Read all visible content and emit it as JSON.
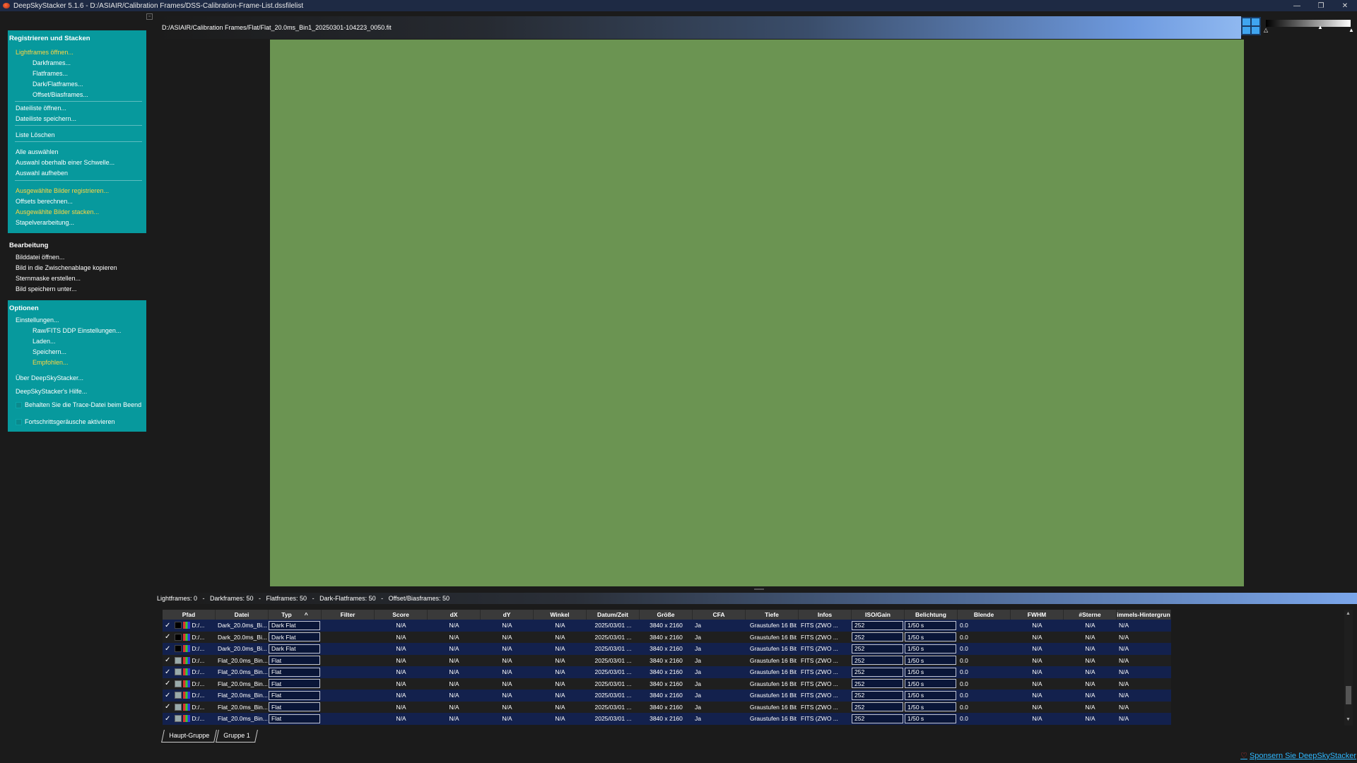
{
  "window": {
    "title": "DeepSkyStacker 5.1.6 - D:/ASIAIR/Calibration Frames/DSS-Calibration-Frame-List.dssfilelist",
    "controls": [
      "—",
      "❐",
      "✕"
    ]
  },
  "sidebar": {
    "collapse_glyph": "▫",
    "stack_section": {
      "title": "Registrieren und Stacken",
      "lightframes": "Lightframes öffnen...",
      "darkframes": "Darkframes...",
      "flatframes": "Flatframes...",
      "darkflatframes": "Dark/Flatframes...",
      "offsetframes": "Offset/Biasframes...",
      "open_list": "Dateiliste öffnen...",
      "save_list": "Dateiliste speichern...",
      "clear_list": "Liste Löschen",
      "select_all": "Alle auswählen",
      "select_threshold": "Auswahl oberhalb einer Schwelle...",
      "deselect": "Auswahl aufheben",
      "register_selected": "Ausgewählte Bilder registrieren...",
      "compute_offsets": "Offsets berechnen...",
      "stack_selected": "Ausgewählte Bilder stacken...",
      "batch": "Stapelverarbeitung..."
    },
    "edit_section": {
      "title": "Bearbeitung",
      "open_image": "Bilddatei öffnen...",
      "copy_clipboard": "Bild in die Zwischenablage kopieren",
      "star_mask": "Sternmaske erstellen...",
      "save_image": "Bild speichern unter..."
    },
    "options_section": {
      "title": "Optionen",
      "settings": "Einstellungen...",
      "raw_fits": "Raw/FITS DDP Einstellungen...",
      "load": "Laden...",
      "save": "Speichern...",
      "recommended": "Empfohlen...",
      "about": "Über DeepSkyStacker...",
      "help": "DeepSkyStacker's Hilfe...",
      "keep_trace": "Behalten Sie die Trace-Datei beim Beend",
      "progress_sounds": "Fortschrittsgeräusche aktivieren"
    }
  },
  "viewer": {
    "file_path": "D:/ASIAIR/Calibration Frames/Flat/Flat_20.0ms_Bin1_20250301-104223_0050.fit",
    "image_color": "#6b9452"
  },
  "counts": {
    "text": "Lightframes: 0   -   Darkframes: 50   -   Flatframes: 50   -   Dark-Flatframes: 50   -   Offset/Biasframes: 50"
  },
  "table": {
    "columns": [
      "Pfad",
      "Datei",
      "Typ",
      "Filter",
      "Score",
      "dX",
      "dY",
      "Winkel",
      "Datum/Zeit",
      "Größe",
      "CFA",
      "Tiefe",
      "Infos",
      "ISO/Gain",
      "Belichtung",
      "Blende",
      "FWHM",
      "#Sterne",
      "immels-Hintergrun"
    ],
    "sort_indicator": "^",
    "rows": [
      {
        "check": "✓",
        "path": "D:/...",
        "file": "Dark_20.0ms_Bi...",
        "type": "Dark Flat",
        "score": "N/A",
        "dx": "N/A",
        "dy": "N/A",
        "angle": "N/A",
        "datetime": "2025/03/01 ...",
        "size": "3840 x 2160",
        "cfa": "Ja",
        "depth": "Graustufen 16 Bit",
        "info": "FITS (ZWO ...",
        "iso": "252",
        "exposure": "1/50 s",
        "aperture": "0.0",
        "fwhm": "N/A",
        "stars": "N/A",
        "bg": "N/A"
      },
      {
        "check": "✓",
        "path": "D:/...",
        "file": "Dark_20.0ms_Bi...",
        "type": "Dark Flat",
        "score": "N/A",
        "dx": "N/A",
        "dy": "N/A",
        "angle": "N/A",
        "datetime": "2025/03/01 ...",
        "size": "3840 x 2160",
        "cfa": "Ja",
        "depth": "Graustufen 16 Bit",
        "info": "FITS (ZWO ...",
        "iso": "252",
        "exposure": "1/50 s",
        "aperture": "0.0",
        "fwhm": "N/A",
        "stars": "N/A",
        "bg": "N/A"
      },
      {
        "check": "✓",
        "path": "D:/...",
        "file": "Dark_20.0ms_Bi...",
        "type": "Dark Flat",
        "score": "N/A",
        "dx": "N/A",
        "dy": "N/A",
        "angle": "N/A",
        "datetime": "2025/03/01 ...",
        "size": "3840 x 2160",
        "cfa": "Ja",
        "depth": "Graustufen 16 Bit",
        "info": "FITS (ZWO ...",
        "iso": "252",
        "exposure": "1/50 s",
        "aperture": "0.0",
        "fwhm": "N/A",
        "stars": "N/A",
        "bg": "N/A"
      },
      {
        "check": "✓",
        "path": "D:/...",
        "file": "Flat_20.0ms_Bin...",
        "type": "Flat",
        "score": "N/A",
        "dx": "N/A",
        "dy": "N/A",
        "angle": "N/A",
        "datetime": "2025/03/01 ...",
        "size": "3840 x 2160",
        "cfa": "Ja",
        "depth": "Graustufen 16 Bit",
        "info": "FITS (ZWO ...",
        "iso": "252",
        "exposure": "1/50 s",
        "aperture": "0.0",
        "fwhm": "N/A",
        "stars": "N/A",
        "bg": "N/A"
      },
      {
        "check": "✓",
        "path": "D:/...",
        "file": "Flat_20.0ms_Bin...",
        "type": "Flat",
        "score": "N/A",
        "dx": "N/A",
        "dy": "N/A",
        "angle": "N/A",
        "datetime": "2025/03/01 ...",
        "size": "3840 x 2160",
        "cfa": "Ja",
        "depth": "Graustufen 16 Bit",
        "info": "FITS (ZWO ...",
        "iso": "252",
        "exposure": "1/50 s",
        "aperture": "0.0",
        "fwhm": "N/A",
        "stars": "N/A",
        "bg": "N/A"
      },
      {
        "check": "✓",
        "path": "D:/...",
        "file": "Flat_20.0ms_Bin...",
        "type": "Flat",
        "score": "N/A",
        "dx": "N/A",
        "dy": "N/A",
        "angle": "N/A",
        "datetime": "2025/03/01 ...",
        "size": "3840 x 2160",
        "cfa": "Ja",
        "depth": "Graustufen 16 Bit",
        "info": "FITS (ZWO ...",
        "iso": "252",
        "exposure": "1/50 s",
        "aperture": "0.0",
        "fwhm": "N/A",
        "stars": "N/A",
        "bg": "N/A"
      },
      {
        "check": "✓",
        "path": "D:/...",
        "file": "Flat_20.0ms_Bin...",
        "type": "Flat",
        "score": "N/A",
        "dx": "N/A",
        "dy": "N/A",
        "angle": "N/A",
        "datetime": "2025/03/01 ...",
        "size": "3840 x 2160",
        "cfa": "Ja",
        "depth": "Graustufen 16 Bit",
        "info": "FITS (ZWO ...",
        "iso": "252",
        "exposure": "1/50 s",
        "aperture": "0.0",
        "fwhm": "N/A",
        "stars": "N/A",
        "bg": "N/A"
      },
      {
        "check": "✓",
        "path": "D:/...",
        "file": "Flat_20.0ms_Bin...",
        "type": "Flat",
        "score": "N/A",
        "dx": "N/A",
        "dy": "N/A",
        "angle": "N/A",
        "datetime": "2025/03/01 ...",
        "size": "3840 x 2160",
        "cfa": "Ja",
        "depth": "Graustufen 16 Bit",
        "info": "FITS (ZWO ...",
        "iso": "252",
        "exposure": "1/50 s",
        "aperture": "0.0",
        "fwhm": "N/A",
        "stars": "N/A",
        "bg": "N/A"
      },
      {
        "check": "✓",
        "path": "D:/...",
        "file": "Flat_20.0ms_Bin...",
        "type": "Flat",
        "score": "N/A",
        "dx": "N/A",
        "dy": "N/A",
        "angle": "N/A",
        "datetime": "2025/03/01 ...",
        "size": "3840 x 2160",
        "cfa": "Ja",
        "depth": "Graustufen 16 Bit",
        "info": "FITS (ZWO ...",
        "iso": "252",
        "exposure": "1/50 s",
        "aperture": "0.0",
        "fwhm": "N/A",
        "stars": "N/A",
        "bg": "N/A"
      }
    ]
  },
  "tabs": [
    "Haupt-Gruppe",
    "Gruppe 1"
  ],
  "sponsor": {
    "label": "Sponsern Sie DeepSkyStacker"
  },
  "colors": {
    "accent_teal": "#07999d",
    "highlight_yellow": "#ffd541",
    "row_blue": "#13214d",
    "link_blue": "#2fb8ff"
  }
}
